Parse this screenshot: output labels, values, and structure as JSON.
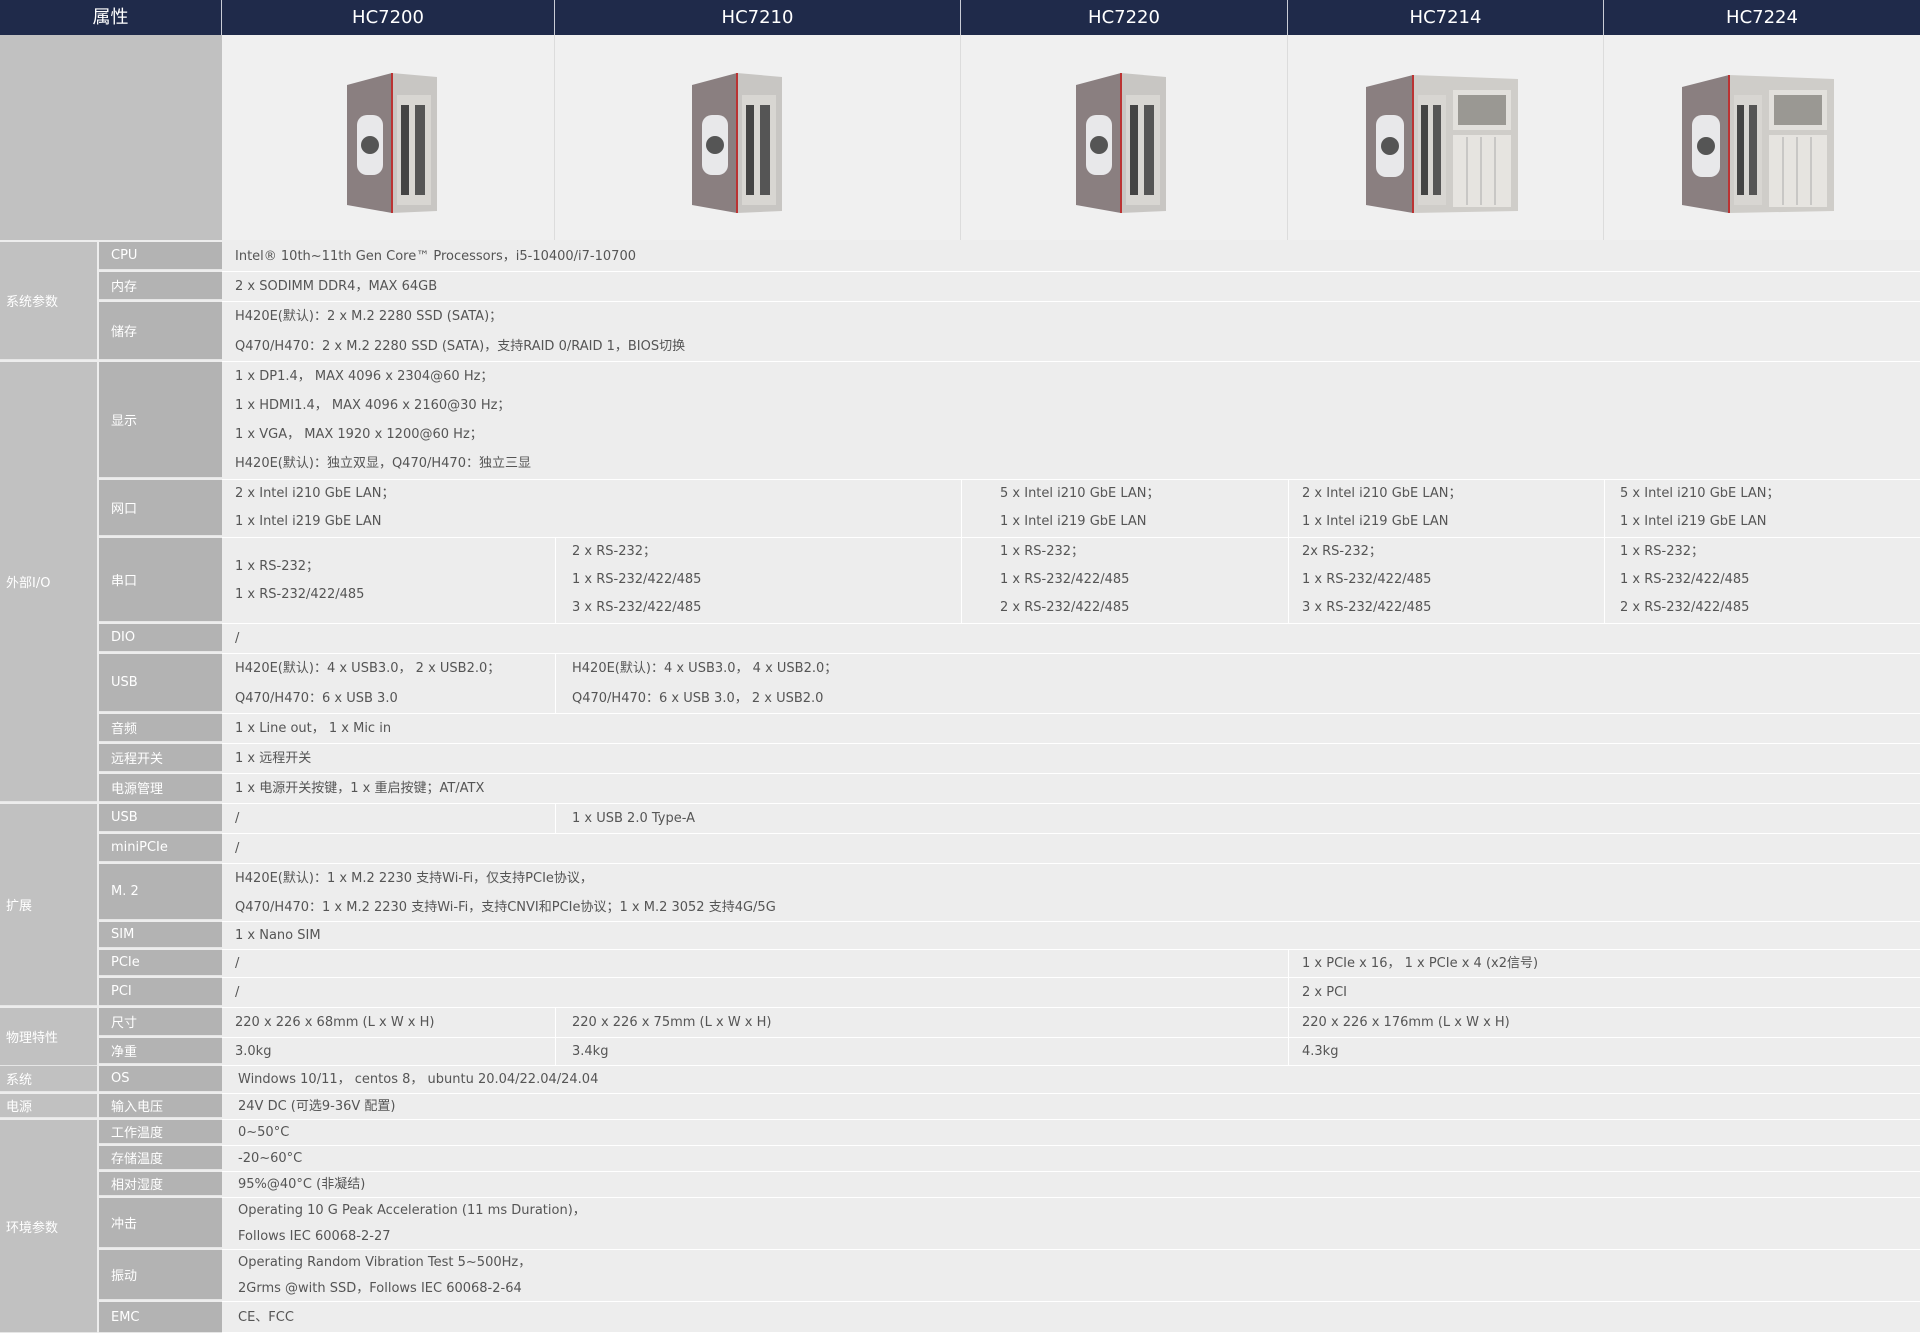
{
  "header": {
    "attr_label": "属性",
    "models": [
      "HC7200",
      "HC7210",
      "HC7220",
      "HC7214",
      "HC7224"
    ]
  },
  "groups": {
    "system_params": "系统参数",
    "external_io": "外部I/O",
    "expansion": "扩展",
    "physical": "物理特性",
    "system": "系统",
    "power": "电源",
    "environment": "环境参数"
  },
  "rows": {
    "cpu": {
      "label": "CPU",
      "value": "Intel® 10th~11th Gen Core™ Processors，i5-10400/i7-10700"
    },
    "memory": {
      "label": "内存",
      "value": "2 x SODIMM DDR4，MAX 64GB"
    },
    "storage": {
      "label": "储存",
      "line1": "H420E(默认)：2 x M.2 2280 SSD (SATA)；",
      "line2": "Q470/H470：2 x M.2 2280 SSD (SATA)，支持RAID 0/RAID 1，BIOS切换"
    },
    "display": {
      "label": "显示",
      "line1": "1 x DP1.4， MAX 4096 x 2304@60 Hz；",
      "line2": "1 x HDMI1.4， MAX 4096 x 2160@30 Hz；",
      "line3": "1 x VGA， MAX 1920 x 1200@60 Hz；",
      "line4": "H420E(默认)：独立双显，Q470/H470：独立三显"
    },
    "lan": {
      "label": "网口",
      "a1": "2 x Intel i210 GbE LAN；",
      "a2": "1 x Intel i219 GbE LAN",
      "b1": "5 x Intel i210 GbE LAN；",
      "b2": "1 x Intel i219 GbE LAN",
      "c1": "2 x Intel i210 GbE LAN；",
      "c2": "1 x Intel i219 GbE LAN",
      "d1": "5 x Intel i210 GbE LAN；",
      "d2": "1 x Intel i219 GbE LAN"
    },
    "serial": {
      "label": "串口",
      "a1": "1 x RS-232；",
      "a2": "1 x RS-232/422/485",
      "b1": "2 x RS-232；",
      "b2": "1 x RS-232/422/485",
      "b3": "3 x RS-232/422/485",
      "c1": "1 x RS-232；",
      "c2": "1 x RS-232/422/485",
      "c3": "2 x RS-232/422/485",
      "d1": "2x RS-232；",
      "d2": "1 x RS-232/422/485",
      "d3": "3 x RS-232/422/485",
      "e1": "1 x RS-232；",
      "e2": "1 x RS-232/422/485",
      "e3": "2 x RS-232/422/485"
    },
    "dio": {
      "label": "DIO",
      "value": "/"
    },
    "usb": {
      "label": "USB",
      "a1": "H420E(默认)：4 x USB3.0， 2 x USB2.0；",
      "a2": "Q470/H470：6 x USB 3.0",
      "b1": "H420E(默认)：4 x USB3.0， 4 x USB2.0；",
      "b2": "Q470/H470：6 x USB 3.0， 2 x USB2.0"
    },
    "audio": {
      "label": "音频",
      "value": "1 x  Line out， 1 x Mic in"
    },
    "remote": {
      "label": "远程开关",
      "value": "1 x 远程开关"
    },
    "power_mgmt": {
      "label": "电源管理",
      "value": "1 x 电源开关按键，1 x 重启按键；AT/ATX"
    },
    "exp_usb": {
      "label": "USB",
      "a": "/",
      "b": "1 x USB 2.0 Type-A"
    },
    "minipcie": {
      "label": "miniPCIe",
      "value": "/"
    },
    "m2": {
      "label": "M. 2",
      "line1": "H420E(默认)：1 x M.2 2230 支持Wi-Fi，仅支持PCIe协议，",
      "line2": "Q470/H470：1 x M.2 2230 支持Wi-Fi，支持CNVI和PCIe协议；1 x M.2 3052 支持4G/5G"
    },
    "sim": {
      "label": "SIM",
      "value": "1 x Nano SIM"
    },
    "pcie": {
      "label": "PCIe",
      "a": "/",
      "b": "1 x PCIe x 16， 1 x PCIe x 4 (x2信号)"
    },
    "pci": {
      "label": "PCI",
      "a": "/",
      "b": "2 x PCI"
    },
    "size": {
      "label": "尺寸",
      "a": "220 x 226 x 68mm (L x W x H)",
      "b": "220 x 226 x 75mm (L x W x H)",
      "c": "220 x 226 x 176mm (L x W x H)"
    },
    "weight": {
      "label": "净重",
      "a": "3.0kg",
      "b": "3.4kg",
      "c": "4.3kg"
    },
    "os": {
      "label": "OS",
      "value": "Windows 10/11， centos 8， ubuntu 20.04/22.04/24.04"
    },
    "input_voltage": {
      "label": "输入电压",
      "value": "24V DC (可选9-36V 配置)"
    },
    "op_temp": {
      "label": "工作温度",
      "value": "0~50°C"
    },
    "storage_temp": {
      "label": "存储温度",
      "value": "-20~60°C"
    },
    "humidity": {
      "label": "相对湿度",
      "value": "95%@40°C (非凝结)"
    },
    "shock": {
      "label": "冲击",
      "line1": "Operating 10 G Peak Acceleration (11 ms Duration)，",
      "line2": "Follows IEC 60068-2-27"
    },
    "vibration": {
      "label": "振动",
      "line1": "Operating Random Vibration Test 5~500Hz，",
      "line2": "2Grms @with SSD，Follows IEC 60068-2-64"
    },
    "emc": {
      "label": "EMC",
      "value": "CE、FCC"
    }
  }
}
